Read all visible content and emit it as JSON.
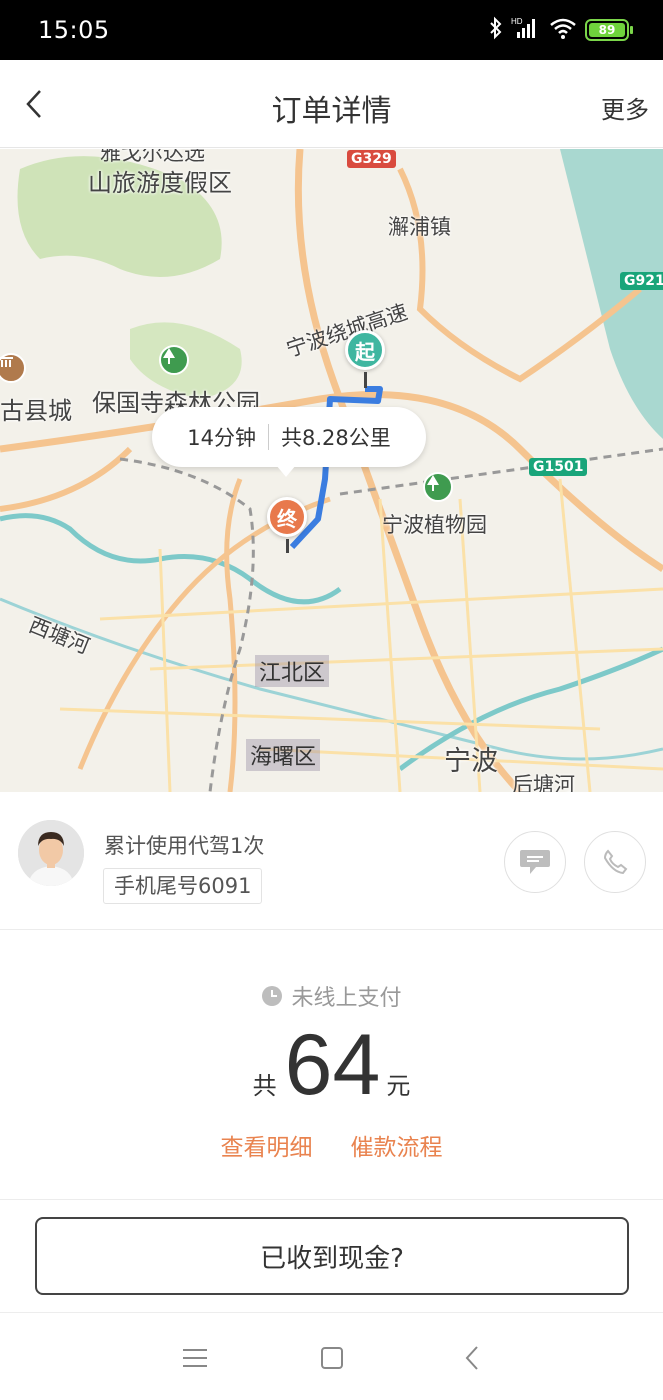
{
  "status_bar": {
    "time": "15:05",
    "battery": "89",
    "icons": [
      "bluetooth-icon",
      "signal-icon",
      "wifi-icon",
      "battery-icon"
    ]
  },
  "nav": {
    "title": "订单详情",
    "more": "更多"
  },
  "map": {
    "labels": {
      "resort": "山旅游度假区",
      "resort_top": "雅戈尔达选",
      "town": "澥浦镇",
      "forest_park": "保国寺森林公园",
      "old_county": "古县城",
      "expressway": "宁波绕城高速",
      "botanical": "宁波植物园",
      "river_west": "西塘河",
      "jiangbei": "江北区",
      "haishu": "海曙区",
      "ningbo": "宁波",
      "river_hou": "后塘河"
    },
    "road_badges": {
      "g329": "G329",
      "g921": "G921",
      "g1501": "G1501"
    },
    "start_pin": "起",
    "end_pin": "终",
    "route_bubble": {
      "duration": "14分钟",
      "distance": "共8.28公里"
    }
  },
  "driver": {
    "usage": "累计使用代驾1次",
    "phone_tail": "手机尾号6091"
  },
  "payment": {
    "status": "未线上支付",
    "amount_prefix": "共",
    "amount": "64",
    "amount_unit": "元",
    "detail_link": "查看明细",
    "flow_link": "催款流程",
    "accent_color": "#e9834f"
  },
  "cash_button": "已收到现金?"
}
